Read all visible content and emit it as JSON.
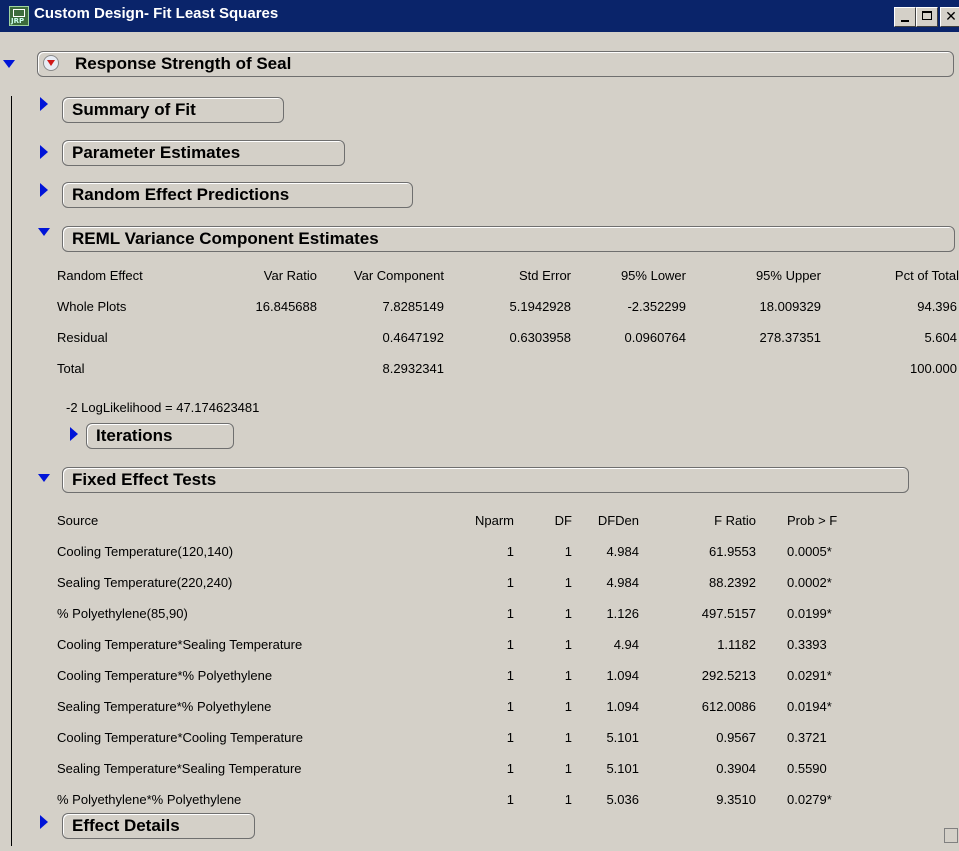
{
  "window": {
    "title": "Custom Design- Fit Least Squares",
    "app_icon_text": "JRP"
  },
  "report": {
    "title": "Response Strength of Seal",
    "sections": {
      "summary_of_fit": "Summary of Fit",
      "parameter_estimates": "Parameter Estimates",
      "random_effect_predictions": "Random Effect Predictions",
      "reml": "REML Variance Component Estimates",
      "iterations": "Iterations",
      "fixed_effect_tests": "Fixed Effect Tests",
      "effect_details": "Effect Details"
    }
  },
  "reml": {
    "columns": [
      "Random Effect",
      "Var Ratio",
      "Var Component",
      "Std Error",
      "95% Lower",
      "95% Upper",
      "Pct of Total"
    ],
    "rows": [
      [
        "Whole Plots",
        "16.845688",
        "7.8285149",
        "5.1942928",
        "-2.352299",
        "18.009329",
        "94.396"
      ],
      [
        "Residual",
        "",
        "0.4647192",
        "0.6303958",
        "0.0960764",
        "278.37351",
        "5.604"
      ],
      [
        "Total",
        "",
        "8.2932341",
        "",
        "",
        "",
        "100.000"
      ]
    ],
    "loglik": "-2 LogLikelihood =  47.174623481"
  },
  "fixed_effect_tests": {
    "columns": [
      "Source",
      "Nparm",
      "DF",
      "DFDen",
      "F Ratio",
      "Prob > F"
    ],
    "rows": [
      [
        "Cooling Temperature(120,140)",
        "1",
        "1",
        "4.984",
        "61.9553",
        "0.0005*"
      ],
      [
        "Sealing Temperature(220,240)",
        "1",
        "1",
        "4.984",
        "88.2392",
        "0.0002*"
      ],
      [
        "% Polyethylene(85,90)",
        "1",
        "1",
        "1.126",
        "497.5157",
        "0.0199*"
      ],
      [
        "Cooling Temperature*Sealing Temperature",
        "1",
        "1",
        "4.94",
        "1.1182",
        "0.3393"
      ],
      [
        "Cooling Temperature*% Polyethylene",
        "1",
        "1",
        "1.094",
        "292.5213",
        "0.0291*"
      ],
      [
        "Sealing Temperature*% Polyethylene",
        "1",
        "1",
        "1.094",
        "612.0086",
        "0.0194*"
      ],
      [
        "Cooling Temperature*Cooling Temperature",
        "1",
        "1",
        "5.101",
        "0.9567",
        "0.3721"
      ],
      [
        "Sealing Temperature*Sealing Temperature",
        "1",
        "1",
        "5.101",
        "0.3904",
        "0.5590"
      ],
      [
        "% Polyethylene*% Polyethylene",
        "1",
        "1",
        "5.036",
        "9.3510",
        "0.0279*"
      ]
    ]
  }
}
